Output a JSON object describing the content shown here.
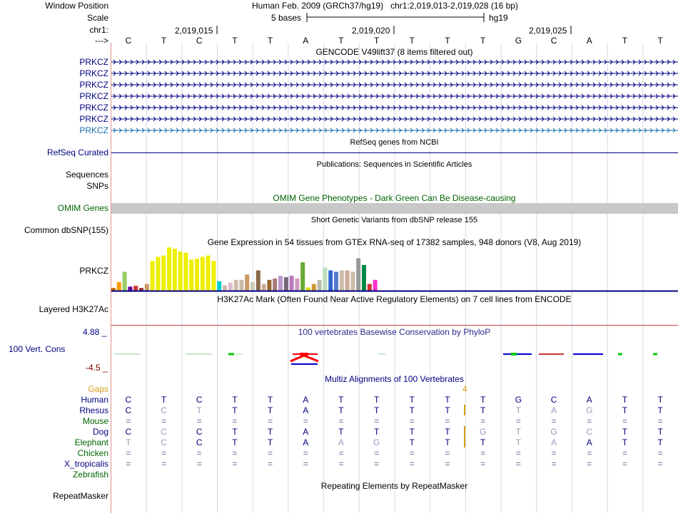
{
  "header": {
    "window_position_label": "Window Position",
    "scale_label": "Scale",
    "chrom_label": "chr1:",
    "strand_label": "--->",
    "assembly_text": "Human Feb. 2009 (GRCh37/hg19)",
    "position_text": "chr1:2,019,013-2,019,028 (16 bp)",
    "scale_text": "5 bases",
    "scale_db": "hg19",
    "ruler_ticks": [
      "2,019,015",
      "2,019,020",
      "2,019,025"
    ]
  },
  "bases": [
    "C",
    "T",
    "C",
    "T",
    "T",
    "A",
    "T",
    "T",
    "T",
    "T",
    "T",
    "G",
    "C",
    "A",
    "T",
    "T"
  ],
  "gencode": {
    "title": "GENCODE V49lift37 (8 items filtered out)",
    "items": [
      "PRKCZ",
      "PRKCZ",
      "PRKCZ",
      "PRKCZ",
      "PRKCZ",
      "PRKCZ",
      "PRKCZ"
    ]
  },
  "refseq": {
    "label": "RefSeq Curated",
    "title": "RefSeq genes from NCBI"
  },
  "publications": {
    "label": "Sequences",
    "title": "Publications: Sequences in Scientific Articles"
  },
  "snps": {
    "label": "SNPs"
  },
  "omim": {
    "title": "OMIM Gene Phenotypes - Dark Green Can Be Disease-causing",
    "label": "OMIM Genes"
  },
  "dbsnp": {
    "title": "Short Genetic Variants from dbSNP release 155",
    "label": "Common dbSNP(155)"
  },
  "gtex": {
    "title": "Gene Expression in 54 tissues from GTEx RNA-seq of 17382 samples, 948 donors (V8, Aug 2019)",
    "label": "PRKCZ",
    "bars": [
      {
        "v": 0.1,
        "c": "#cc6600"
      },
      {
        "v": 0.32,
        "c": "#ff9900"
      },
      {
        "v": 0.7,
        "c": "#99cc66"
      },
      {
        "v": 0.15,
        "c": "#660099"
      },
      {
        "v": 0.18,
        "c": "#cc3333"
      },
      {
        "v": 0.1,
        "c": "#993333"
      },
      {
        "v": 0.25,
        "c": "#cc9966"
      },
      {
        "v": 1.1,
        "c": "#eeee00"
      },
      {
        "v": 1.25,
        "c": "#eeee00"
      },
      {
        "v": 1.3,
        "c": "#eeee00"
      },
      {
        "v": 1.6,
        "c": "#eeee00"
      },
      {
        "v": 1.55,
        "c": "#eeee00"
      },
      {
        "v": 1.45,
        "c": "#eeee00"
      },
      {
        "v": 1.4,
        "c": "#eeee00"
      },
      {
        "v": 1.15,
        "c": "#eeee00"
      },
      {
        "v": 1.18,
        "c": "#eeee00"
      },
      {
        "v": 1.25,
        "c": "#eeee00"
      },
      {
        "v": 1.3,
        "c": "#eeee00"
      },
      {
        "v": 1.1,
        "c": "#eeee00"
      },
      {
        "v": 0.35,
        "c": "#00cccc"
      },
      {
        "v": 0.2,
        "c": "#ccbbaa"
      },
      {
        "v": 0.3,
        "c": "#ddbbcc"
      },
      {
        "v": 0.4,
        "c": "#ccbbaa"
      },
      {
        "v": 0.4,
        "c": "#ccbbaa"
      },
      {
        "v": 0.6,
        "c": "#cc9966"
      },
      {
        "v": 0.32,
        "c": "#ccccbb"
      },
      {
        "v": 0.75,
        "c": "#8a6a4a"
      },
      {
        "v": 0.25,
        "c": "#ccaa99"
      },
      {
        "v": 0.4,
        "c": "#996633"
      },
      {
        "v": 0.45,
        "c": "#aa7777"
      },
      {
        "v": 0.55,
        "c": "#bb99cc"
      },
      {
        "v": 0.5,
        "c": "#776677"
      },
      {
        "v": 0.55,
        "c": "#bb77bb"
      },
      {
        "v": 0.45,
        "c": "#cc99bb"
      },
      {
        "v": 1.05,
        "c": "#66aa33"
      },
      {
        "v": 0.12,
        "c": "#dddd00"
      },
      {
        "v": 0.25,
        "c": "#cc9933"
      },
      {
        "v": 0.4,
        "c": "#bbbbaa"
      },
      {
        "v": 0.85,
        "c": "#bbddbb"
      },
      {
        "v": 0.75,
        "c": "#3366cc"
      },
      {
        "v": 0.7,
        "c": "#5577cc"
      },
      {
        "v": 0.75,
        "c": "#ccbbaa"
      },
      {
        "v": 0.75,
        "c": "#ccaa99"
      },
      {
        "v": 0.7,
        "c": "#ccbbaa"
      },
      {
        "v": 1.2,
        "c": "#999999"
      },
      {
        "v": 0.95,
        "c": "#008844"
      },
      {
        "v": 0.25,
        "c": "#cc3333"
      },
      {
        "v": 0.4,
        "c": "#ff33cc"
      }
    ]
  },
  "h3k27ac": {
    "title": "H3K27Ac Mark (Often Found Near Active Regulatory Elements) on 7 cell lines from ENCODE",
    "label": "Layered H3K27Ac"
  },
  "phylop": {
    "title": "100 vertebrates Basewise Conservation by PhyloP",
    "label": "100 Vert. Cons",
    "max": "4.88 _",
    "min": "-4.5 _"
  },
  "multiz": {
    "title": "Multiz Alignments of 100 Vertebrates",
    "gaps_label": "Gaps",
    "gap_count": "4",
    "species": [
      {
        "name": "Human",
        "color": "#000080",
        "seq": [
          "C",
          "T",
          "C",
          "T",
          "T",
          "A",
          "T",
          "T",
          "T",
          "T",
          "T",
          "G",
          "C",
          "A",
          "T",
          "T"
        ],
        "match": [
          1,
          1,
          1,
          1,
          1,
          1,
          1,
          1,
          1,
          1,
          1,
          1,
          1,
          1,
          1,
          1
        ]
      },
      {
        "name": "Rhesus",
        "color": "#000080",
        "seq": [
          "C",
          "C",
          "T",
          "T",
          "T",
          "A",
          "T",
          "T",
          "T",
          "T",
          "T",
          "T",
          "A",
          "G",
          "T",
          "T"
        ],
        "match": [
          1,
          0,
          0,
          1,
          1,
          1,
          1,
          1,
          1,
          1,
          1,
          0,
          0,
          0,
          1,
          1
        ]
      },
      {
        "name": "Mouse",
        "color": "#006400",
        "seq": [
          "=",
          "=",
          "=",
          "=",
          "=",
          "=",
          "=",
          "=",
          "=",
          "=",
          "=",
          "=",
          "=",
          "=",
          "=",
          "="
        ],
        "match": [
          0,
          0,
          0,
          0,
          0,
          0,
          0,
          0,
          0,
          0,
          0,
          0,
          0,
          0,
          0,
          0
        ]
      },
      {
        "name": "Dog",
        "color": "#000080",
        "seq": [
          "C",
          "C",
          "C",
          "T",
          "T",
          "A",
          "T",
          "T",
          "T",
          "T",
          "G",
          "T",
          "G",
          "C",
          "T",
          "T"
        ],
        "match": [
          1,
          0,
          1,
          1,
          1,
          1,
          1,
          1,
          1,
          1,
          0,
          0,
          0,
          0,
          1,
          1
        ]
      },
      {
        "name": "Elephant",
        "color": "#006400",
        "seq": [
          "T",
          "C",
          "C",
          "T",
          "T",
          "A",
          "A",
          "G",
          "T",
          "T",
          "T",
          "T",
          "A",
          "A",
          "T",
          "T"
        ],
        "match": [
          0,
          0,
          1,
          1,
          1,
          1,
          0,
          0,
          1,
          1,
          1,
          0,
          0,
          1,
          1,
          1
        ]
      },
      {
        "name": "Chicken",
        "color": "#006400",
        "seq": [
          "=",
          "=",
          "=",
          "=",
          "=",
          "=",
          "=",
          "=",
          "=",
          "=",
          "=",
          "=",
          "=",
          "=",
          "=",
          "="
        ],
        "match": [
          0,
          0,
          0,
          0,
          0,
          0,
          0,
          0,
          0,
          0,
          0,
          0,
          0,
          0,
          0,
          0
        ]
      },
      {
        "name": "X_tropicalis",
        "color": "#000080",
        "seq": [
          "=",
          "=",
          "=",
          "=",
          "=",
          "=",
          "=",
          "=",
          "=",
          "=",
          "=",
          "=",
          "=",
          "=",
          "=",
          "="
        ],
        "match": [
          0,
          0,
          0,
          0,
          0,
          0,
          0,
          0,
          0,
          0,
          0,
          0,
          0,
          0,
          0,
          0
        ]
      },
      {
        "name": "Zebrafish",
        "color": "#006400",
        "seq": [
          "",
          "",
          "",
          "",
          "",
          "",
          "",
          "",
          "",
          "",
          "",
          "",
          "",
          "",
          "",
          ""
        ],
        "match": [
          0,
          0,
          0,
          0,
          0,
          0,
          0,
          0,
          0,
          0,
          0,
          0,
          0,
          0,
          0,
          0
        ]
      }
    ]
  },
  "repeatmasker": {
    "title": "Repeating Elements by RepeatMasker",
    "label": "RepeatMasker"
  },
  "colors": {
    "gene": "#000080",
    "gene_alt": "#1a6ea8",
    "omim": "#006400",
    "omim_bar": "#c8c8c8",
    "gaps": "#d4a017",
    "h3k27ac_line": "#c04040",
    "phylop_label": "#000080",
    "phylop_min": "#800000",
    "grid": "#d8d8ea"
  }
}
